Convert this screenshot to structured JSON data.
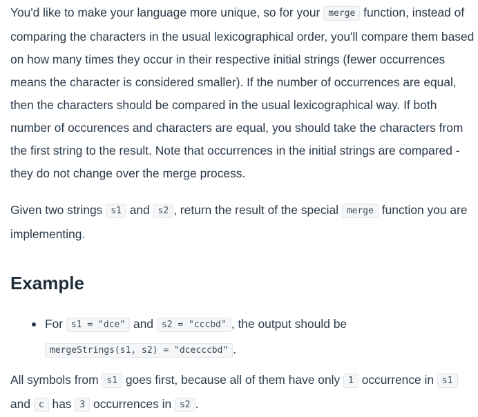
{
  "para1": {
    "t1": "You'd like to make your language more unique, so for your ",
    "c1": "merge",
    "t2": " function, instead of comparing the characters in the usual lexicographical order, you'll compare them based on how many times they occur in their respective initial strings (fewer occurrences means the character is considered smaller). If the number of occurrences are equal, then the characters should be compared in the usual lexicographical way. If both number of occurences and characters are equal, you should take the characters from the first string to the result. Note that occurrences in the initial strings are compared - they do not change over the merge process."
  },
  "para2": {
    "t1": "Given two strings ",
    "c1": "s1",
    "t2": " and ",
    "c2": "s2",
    "t3": ", return the result of the special ",
    "c3": "merge",
    "t4": " function you are implementing."
  },
  "example": {
    "heading": "Example",
    "item": {
      "t1": "For ",
      "c1": "s1 = \"dce\"",
      "t2": " and ",
      "c2": "s2 = \"cccbd\"",
      "t3": ", the output should be",
      "c3": "mergeStrings(s1, s2) = \"dcecccbd\"",
      "t4": "."
    }
  },
  "para3": {
    "t1": "All symbols from ",
    "c1": "s1",
    "t2": " goes first, because all of them have only ",
    "c2": "1",
    "t3": " occurrence in ",
    "c3": "s1",
    "t4": " and ",
    "c4": "c",
    "t5": " has ",
    "c5": "3",
    "t6": " occurrences in ",
    "c6": "s2",
    "t7": "."
  }
}
